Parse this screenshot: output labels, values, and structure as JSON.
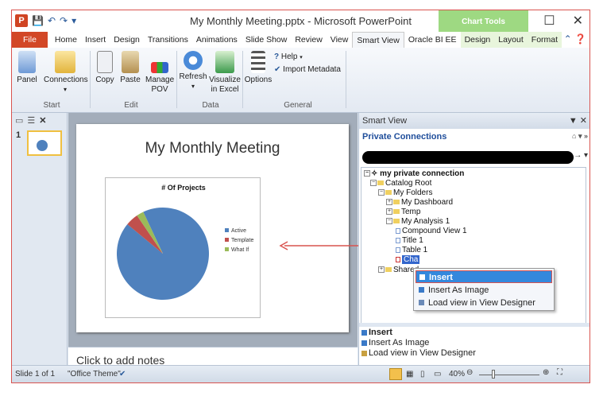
{
  "window": {
    "title": "My Monthly Meeting.pptx - Microsoft PowerPoint",
    "chart_tools_label": "Chart Tools",
    "minimize": "–",
    "maximize": "☐",
    "close": "✕"
  },
  "tabs": [
    "File",
    "Home",
    "Insert",
    "Design",
    "Transitions",
    "Animations",
    "Slide Show",
    "Review",
    "View",
    "Smart View",
    "Oracle BI EE",
    "Design",
    "Layout",
    "Format"
  ],
  "ribbon": {
    "buttons": {
      "panel": "Panel",
      "connections": "Connections",
      "copy": "Copy",
      "paste": "Paste",
      "manage_pov_1": "Manage",
      "manage_pov_2": "POV",
      "refresh": "Refresh",
      "visualize_1": "Visualize",
      "visualize_2": "in Excel",
      "options": "Options",
      "help": "Help",
      "import_metadata": "Import Metadata"
    },
    "groups": {
      "start": "Start",
      "edit": "Edit",
      "data": "Data",
      "general": "General"
    }
  },
  "slides_pane": {
    "slide_number": "1"
  },
  "slide": {
    "title": "My Monthly Meeting",
    "notes_placeholder": "Click to add notes"
  },
  "chart_data": {
    "type": "pie",
    "title": "# Of Projects",
    "categories": [
      "Active",
      "Template",
      "What If"
    ],
    "values": [
      93,
      4.5,
      2.5
    ],
    "colors": [
      "#4f81bd",
      "#c0504d",
      "#9bbb59"
    ],
    "legend_position": "right"
  },
  "smart_view": {
    "pane_title": "Smart View",
    "private_connections": "Private Connections",
    "tree": {
      "connection": "my private connection",
      "catalog_root": "Catalog Root",
      "my_folders": "My Folders",
      "my_dashboard": "My Dashboard",
      "temp": "Temp",
      "my_analysis": "My Analysis 1",
      "compound_view": "Compound View 1",
      "title": "Title 1",
      "table": "Table 1",
      "chart": "Cha",
      "shared": "Shared"
    },
    "context_menu": [
      "Insert",
      "Insert As Image",
      "Load view in View Designer"
    ],
    "footer_actions": [
      "Insert",
      "Insert As Image",
      "Load view in View Designer"
    ]
  },
  "status_bar": {
    "slide_info": "Slide 1 of 1",
    "theme": "\"Office Theme\"",
    "zoom": "40%"
  }
}
